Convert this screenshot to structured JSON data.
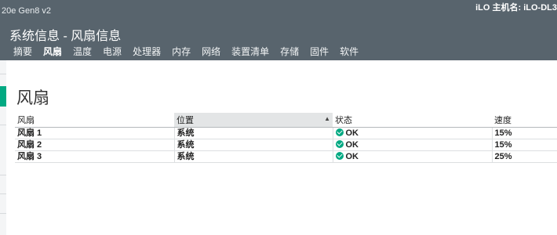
{
  "header": {
    "product_name": "20e Gen8 v2",
    "hostname": "iLO 主机名:  iLO-DL3",
    "section": "系统信息",
    "separator": " - ",
    "page": "风扇信息"
  },
  "tabs": [
    {
      "label": "摘要"
    },
    {
      "label": "风扇"
    },
    {
      "label": "温度"
    },
    {
      "label": "电源"
    },
    {
      "label": "处理器"
    },
    {
      "label": "内存"
    },
    {
      "label": "网络"
    },
    {
      "label": "装置清单"
    },
    {
      "label": "存储"
    },
    {
      "label": "固件"
    },
    {
      "label": "软件"
    }
  ],
  "active_tab": "风扇",
  "content": {
    "title": "风扇",
    "table": {
      "headers": [
        "风扇",
        "位置",
        "状态",
        "速度"
      ],
      "sorted_column": "位置",
      "rows": [
        {
          "fan": "风扇 1",
          "location": "系统",
          "status": "OK",
          "speed": "15%"
        },
        {
          "fan": "风扇 2",
          "location": "系统",
          "status": "OK",
          "speed": "15%"
        },
        {
          "fan": "风扇 3",
          "location": "系统",
          "status": "OK",
          "speed": "25%"
        }
      ]
    }
  },
  "colors": {
    "header_bg": "#58646d",
    "ok_green": "#01a982",
    "accent": "#01a982"
  }
}
